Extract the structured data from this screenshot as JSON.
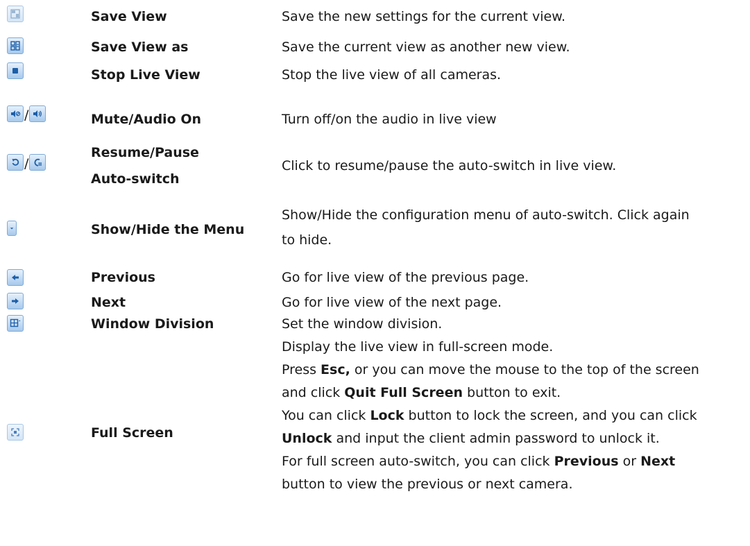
{
  "rows": [
    {
      "name": "Save View",
      "desc": "Save the new settings for the current view.",
      "icon": "save-view-icon"
    },
    {
      "name": "Save View as",
      "desc": "Save the current view as another new view.",
      "icon": "save-view-as-icon"
    },
    {
      "name": "Stop Live View",
      "desc": "Stop the live view of all cameras.",
      "icon": "stop-icon"
    },
    {
      "name": "Mute/Audio On",
      "desc": "Turn off/on the audio in live view",
      "icons": [
        "mute-icon",
        "audio-on-icon"
      ],
      "separator": "/"
    },
    {
      "name_lines": [
        "Resume/Pause",
        "Auto-switch"
      ],
      "desc": "Click to resume/pause the auto-switch in live view.",
      "icons": [
        "resume-icon",
        "pause-icon"
      ],
      "separator": "/"
    },
    {
      "name": "Show/Hide the Menu",
      "desc_lines": [
        "Show/Hide the configuration menu of auto-switch. Click again",
        "to hide."
      ],
      "icon": "chevron-down-icon"
    },
    {
      "name": "Previous",
      "desc": "Go for live view of the previous page.",
      "icon": "arrow-left-icon"
    },
    {
      "name": "Next",
      "desc": "Go for live view of the next page.",
      "icon": "arrow-right-icon"
    },
    {
      "name": "Window Division",
      "desc": "Set the window division.",
      "icon": "window-division-icon"
    },
    {
      "name": "Full Screen",
      "icon": "full-screen-icon",
      "full_screen_desc": {
        "l1": "Display the live view in full-screen mode.",
        "l2_pre": "Press ",
        "l2_bold": "Esc,",
        "l2_post": " or you can move the mouse to the top of the screen",
        "l3_pre": "and click ",
        "l3_bold": "Quit Full Screen",
        "l3_post": " button to exit.",
        "l4_pre": "You can click ",
        "l4_bold": "Lock",
        "l4_post": " button to lock the screen, and you can click",
        "l5_bold": "Unlock",
        "l5_post": " and input the client admin password to unlock it.",
        "l6_pre": "For full screen auto-switch, you can click ",
        "l6_bold1": "Previous",
        "l6_mid": " or ",
        "l6_bold2": "Next",
        "l7": "button to view the previous or next camera."
      }
    }
  ],
  "colors": {
    "button_border": "#7ea9d6",
    "button_top": "#e6f1fc",
    "button_bottom": "#a7c9ec",
    "icon": "#1d5fa8"
  }
}
